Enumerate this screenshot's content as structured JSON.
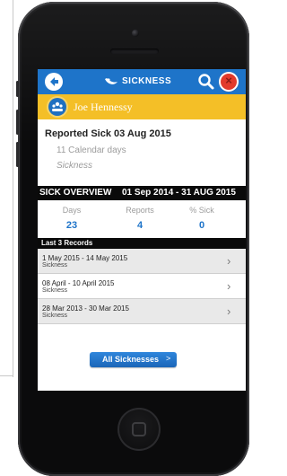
{
  "nav": {
    "title": "SICKNESS",
    "back_icon": "back-arrow-icon",
    "logo_icon": "sickness-logo-icon",
    "search_icon": "search-icon",
    "close_icon": "close-icon",
    "close_glyph": "×",
    "colors": {
      "bar": "#1e74c9",
      "close": "#e23a2c"
    }
  },
  "user": {
    "name": "Joe Hennessy",
    "avatar_icon": "user-group-icon",
    "bar_color": "#f4bf27"
  },
  "summary": {
    "title": "Reported Sick 03 Aug 2015",
    "duration": "11 Calendar days",
    "type": "Sickness"
  },
  "overview": {
    "label": "SICK OVERVIEW",
    "range": "01 Sep 2014 - 31 AUG 2015",
    "stats": [
      {
        "label": "Days",
        "value": "23"
      },
      {
        "label": "Reports",
        "value": "4"
      },
      {
        "label": "% Sick",
        "value": "0"
      }
    ],
    "value_color": "#1e74c9"
  },
  "records": {
    "header": "Last 3 Records",
    "items": [
      {
        "dates": "1 May 2015 - 14 May  2015",
        "type": "Sickness",
        "chevron": "›"
      },
      {
        "dates": "08 April -  10 April 2015",
        "type": "Sickness",
        "chevron": "›"
      },
      {
        "dates": "28 Mar 2013 - 30 Mar 2015",
        "type": "Sickness",
        "chevron": "›"
      }
    ]
  },
  "all_button": {
    "label": "All Sicknesses",
    "chevron": ">"
  }
}
